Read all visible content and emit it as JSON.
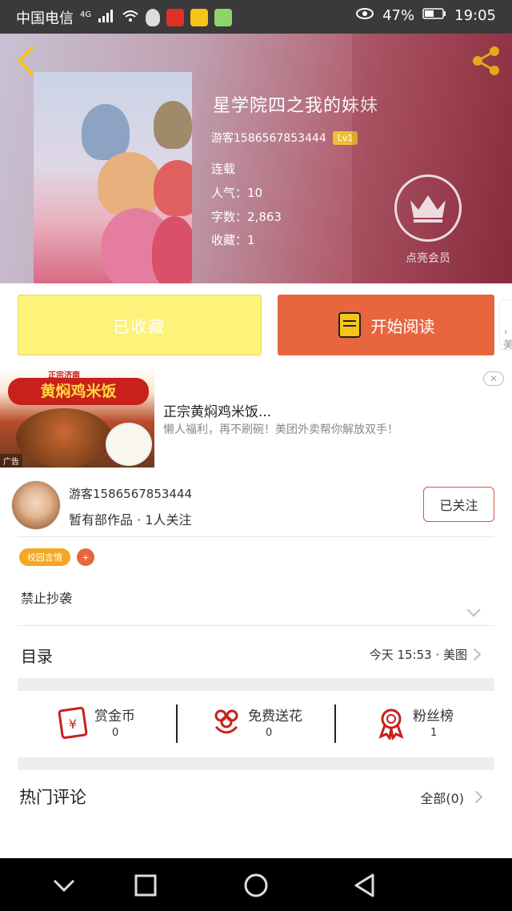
{
  "status_bar": {
    "carrier": "中国电信",
    "network": "4G",
    "battery": "47%",
    "time": "19:05"
  },
  "book": {
    "title": "星学院四之我的妹妹",
    "author": "游客1586567853444",
    "level": "Lv1",
    "status": "连载",
    "popularity_label": "人气：",
    "popularity": "10",
    "words_label": "字数：",
    "words": "2,863",
    "favorites_label": "收藏：",
    "favorites": "1",
    "vip_label": "点亮会员"
  },
  "actions": {
    "favorited_label": "已收藏",
    "read_label": "开始阅读",
    "peek_label": "，美"
  },
  "ad": {
    "image_banner": "黄焖鸡米饭",
    "image_top": "正宗济南",
    "image_tag": "广告",
    "title": "正宗黄焖鸡米饭...",
    "desc": "懒人福利，再不刷碗！美团外卖帮你解放双手！",
    "close": "✕"
  },
  "author_card": {
    "name": "游客1586567853444",
    "stats": "暂有部作品 · 1人关注",
    "follow_label": "已关注",
    "tags": [
      {
        "label": "校园言情",
        "color": "#f5a623"
      },
      {
        "label": "+",
        "color": "#e8663e"
      }
    ],
    "description": "禁止抄袭"
  },
  "toc": {
    "title": "目录",
    "updated": "今天 15:53 · 美图"
  },
  "stats": [
    {
      "label": "赏金币",
      "value": "0",
      "icon": "red-envelope-icon"
    },
    {
      "label": "免费送花",
      "value": "0",
      "icon": "flower-icon"
    },
    {
      "label": "粉丝榜",
      "value": "1",
      "icon": "medal-icon"
    }
  ],
  "comments": {
    "title": "热门评论",
    "all_label": "全部(0)"
  },
  "colors": {
    "accent": "#e8663e",
    "fav_button": "#fdf27a",
    "tag_yellow": "#f5a623",
    "navbar": "#000000"
  }
}
